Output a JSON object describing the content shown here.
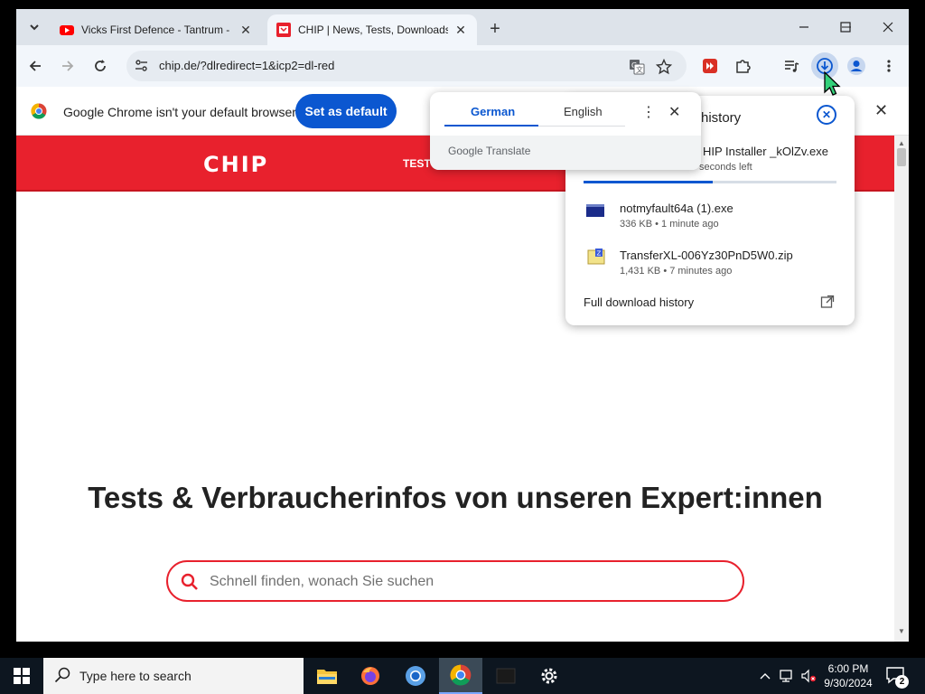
{
  "browser": {
    "tabs": [
      {
        "title": "Vicks First Defence - Tantrum -",
        "favicon": "youtube-icon",
        "active": false
      },
      {
        "title": "CHIP | News, Tests, Downloads",
        "favicon": "chip-icon",
        "active": true
      }
    ],
    "new_tab": "+",
    "url": "chip.de/?dlredirect=1&icp2=dl-red"
  },
  "infobar": {
    "message": "Google Chrome isn't your default browser",
    "button": "Set as default"
  },
  "page": {
    "logo": "CHIP",
    "nav_item": "TEST & KAUFBERATUNG",
    "headline": "Tests & Verbraucherinfos von unseren Expert:innen",
    "search_placeholder": "Schnell finden, wonach Sie suchen"
  },
  "downloads": {
    "title_visible": "history",
    "items": [
      {
        "name": "HIP Installer _kOlZv.exe",
        "meta": "seconds left",
        "progress": 0.51
      },
      {
        "name": "notmyfault64a (1).exe",
        "meta": "336 KB • 1 minute ago"
      },
      {
        "name": "TransferXL-006Yz30PnD5W0.zip",
        "meta": "1,431 KB • 7 minutes ago"
      }
    ],
    "full_history": "Full download history"
  },
  "translate": {
    "source": "German",
    "target": "English",
    "brand": "Google Translate"
  },
  "taskbar": {
    "search_placeholder": "Type here to search",
    "time": "6:00 PM",
    "date": "9/30/2024",
    "notification_count": "2"
  },
  "colors": {
    "chip_red": "#e8212d",
    "chrome_blue": "#0b57d0",
    "tabstrip": "#dde3ea"
  }
}
